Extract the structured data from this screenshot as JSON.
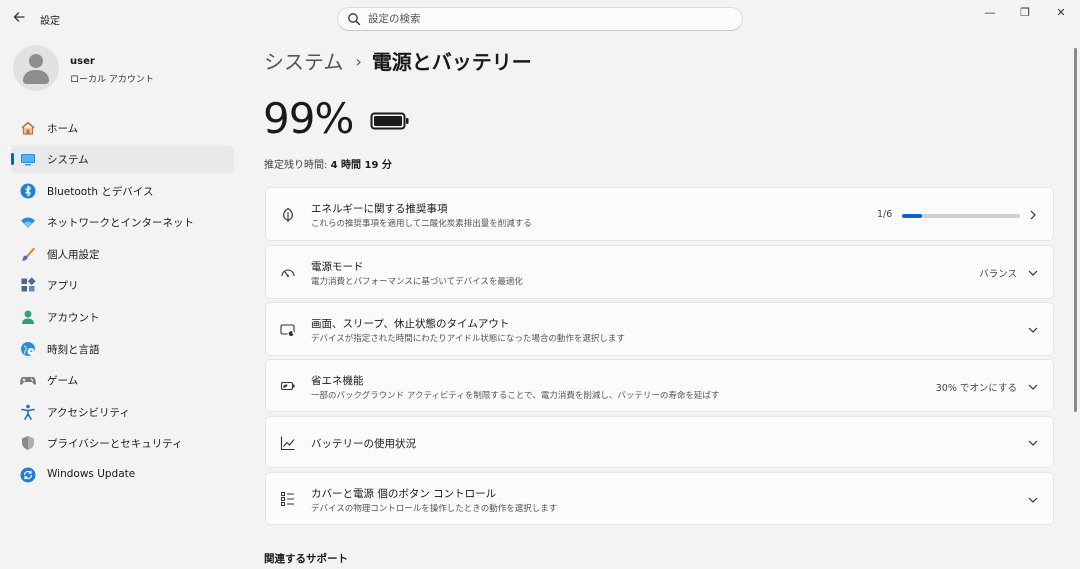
{
  "window": {
    "back_icon": "back-arrow-icon",
    "title": "設定",
    "controls": {
      "minimize": "—",
      "maximize": "❐",
      "close": "✕"
    }
  },
  "search": {
    "placeholder": "設定の検索",
    "icon": "search-icon"
  },
  "profile": {
    "name": "user",
    "account_type": "ローカル アカウント"
  },
  "sidebar": {
    "items": [
      {
        "label": "ホーム",
        "icon": "home-icon",
        "selected": false
      },
      {
        "label": "システム",
        "icon": "system-monitor-icon",
        "selected": true
      },
      {
        "label": "Bluetooth とデバイス",
        "icon": "bluetooth-icon",
        "selected": false
      },
      {
        "label": "ネットワークとインターネット",
        "icon": "wifi-icon",
        "selected": false
      },
      {
        "label": "個人用設定",
        "icon": "paintbrush-icon",
        "selected": false
      },
      {
        "label": "アプリ",
        "icon": "apps-icon",
        "selected": false
      },
      {
        "label": "アカウント",
        "icon": "account-icon",
        "selected": false
      },
      {
        "label": "時刻と言語",
        "icon": "globe-clock-icon",
        "selected": false
      },
      {
        "label": "ゲーム",
        "icon": "gamepad-icon",
        "selected": false
      },
      {
        "label": "アクセシビリティ",
        "icon": "accessibility-icon",
        "selected": false
      },
      {
        "label": "プライバシーとセキュリティ",
        "icon": "shield-icon",
        "selected": false
      },
      {
        "label": "Windows Update",
        "icon": "windows-update-icon",
        "selected": false
      }
    ]
  },
  "breadcrumb": {
    "parent": "システム",
    "separator": "›",
    "current": "電源とバッテリー"
  },
  "battery": {
    "percent": "99%",
    "estimate_label": "推定残り時間: ",
    "hours": "4",
    "hours_unit": " 時間 ",
    "minutes": "19",
    "minutes_unit": " 分"
  },
  "cards": {
    "energy": {
      "title": "エネルギーに関する推奨事項",
      "desc": "これらの推奨事項を適用して二酸化炭素排出量を削減する",
      "progress_label": "1/6",
      "progress_fraction": 0.1667,
      "icon": "leaf-icon"
    },
    "power_mode": {
      "title": "電源モード",
      "desc": "電力消費とパフォーマンスに基づいてデバイスを最適化",
      "value": "バランス",
      "icon": "gauge-icon"
    },
    "screen_sleep": {
      "title": "画面、スリープ、休止状態のタイムアウト",
      "desc": "デバイスが指定された時間にわたりアイドル状態になった場合の動作を選択します",
      "icon": "screen-sleep-icon"
    },
    "energy_saver": {
      "title": "省エネ機能",
      "desc": "一部のバックグラウンド アクティビティを制限することで、電力消費を削減し、バッテリーの寿命を延ばす",
      "value": "30% でオンにする",
      "icon": "energy-saver-icon"
    },
    "battery_usage": {
      "title": "バッテリーの使用状況",
      "icon": "chart-line-icon"
    },
    "lid_buttons": {
      "title": "カバーと電源 個のボタン コントロール",
      "desc": "デバイスの物理コントロールを操作したときの動作を選択します",
      "icon": "list-controls-icon"
    }
  },
  "related_support": {
    "heading": "関連するサポート"
  },
  "colors": {
    "accent": "#0067c0",
    "background": "#f3f3f3",
    "card": "#fbfbfb"
  }
}
